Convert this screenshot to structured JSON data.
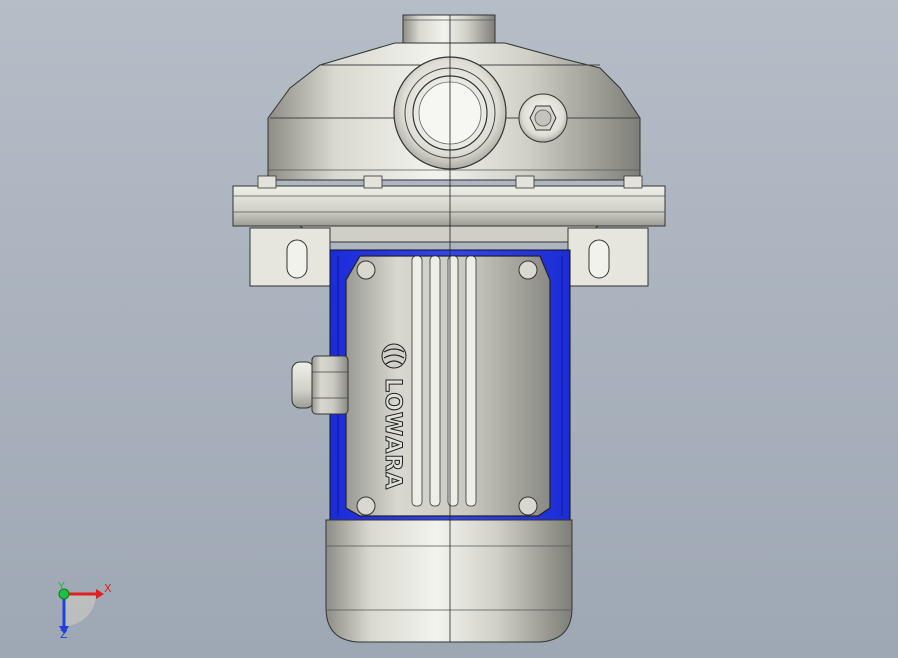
{
  "viewport": {
    "background_top": "#b5bdc7",
    "background_bottom": "#9ea8b4"
  },
  "model": {
    "brand_label": "LOWARA",
    "housing_color": "#2a3fe0",
    "metal_color": "#d8d8d0"
  },
  "triad": {
    "x_label": "X",
    "y_label": "Y",
    "z_label": "Z",
    "x_color": "#e02020",
    "y_color": "#20c040",
    "z_color": "#2040e0"
  }
}
